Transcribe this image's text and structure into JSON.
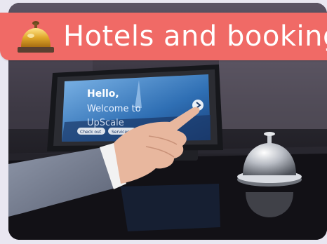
{
  "banner": {
    "emoji": "🛎️",
    "title": "Hotels and booking"
  },
  "photo": {
    "screen_greeting": "Hello,",
    "screen_welcome": "Welcome to",
    "screen_brand": "UpScale",
    "screen_btn_1": "Check out",
    "screen_btn_2": "Services"
  },
  "colors": {
    "banner_bg": "#f06a66",
    "banner_text": "#ffffff",
    "page_bg": "#e9e7f1"
  }
}
